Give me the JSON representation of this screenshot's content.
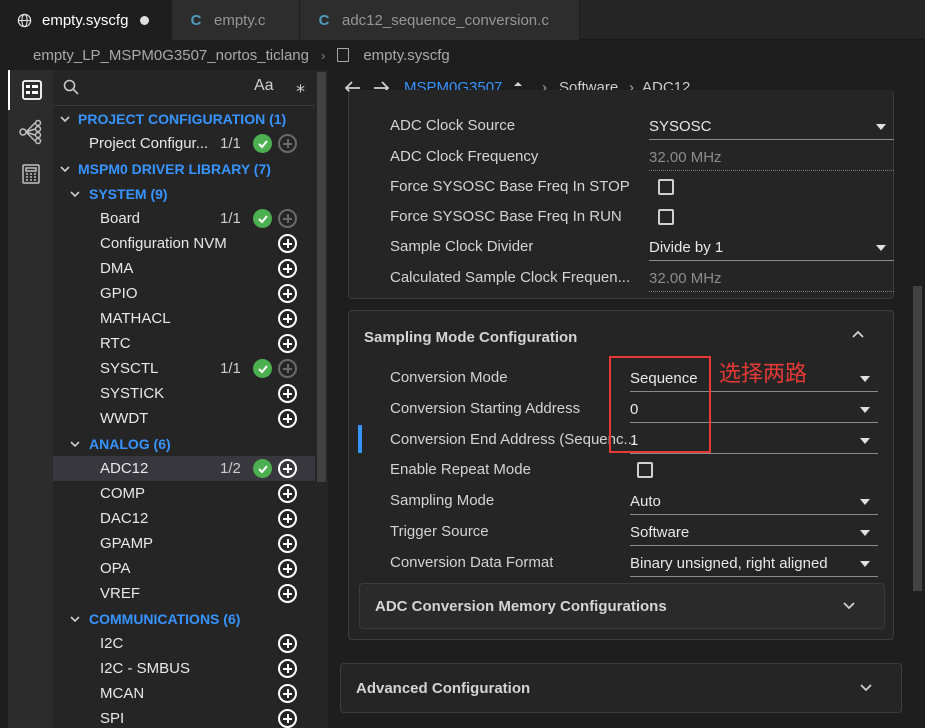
{
  "tabs": [
    {
      "label": "empty.syscfg",
      "icon": "globe-icon",
      "active": true,
      "modified": true
    },
    {
      "label": "empty.c",
      "icon": "c-file-icon",
      "active": false
    },
    {
      "label": "adc12_sequence_conversion.c",
      "icon": "c-file-icon",
      "active": false
    }
  ],
  "breadcrumb": {
    "project": "empty_LP_MSPM0G3507_nortos_ticlang",
    "file": "empty.syscfg"
  },
  "activity_bar": [
    "tree-view-icon",
    "hierarchy-icon",
    "calculator-icon"
  ],
  "tree": {
    "search_icon": "search-icon",
    "case_toggle": "Aa",
    "filter_icon": "asterisk-icon",
    "project_config": {
      "label": "PROJECT CONFIGURATION (1)",
      "items": [
        {
          "label": "Project Configur...",
          "count": "1/1",
          "ok": true
        }
      ]
    },
    "driver_library": {
      "label": "MSPM0 DRIVER LIBRARY (7)"
    },
    "system": {
      "label": "SYSTEM (9)",
      "items": [
        {
          "label": "Board",
          "count": "1/1"
        },
        {
          "label": "Configuration NVM"
        },
        {
          "label": "DMA"
        },
        {
          "label": "GPIO"
        },
        {
          "label": "MATHACL"
        },
        {
          "label": "RTC"
        },
        {
          "label": "SYSCTL",
          "count": "1/1"
        },
        {
          "label": "SYSTICK"
        },
        {
          "label": "WWDT"
        }
      ]
    },
    "analog": {
      "label": "ANALOG (6)",
      "items": [
        {
          "label": "ADC12",
          "count": "1/2"
        },
        {
          "label": "COMP"
        },
        {
          "label": "DAC12"
        },
        {
          "label": "GPAMP"
        },
        {
          "label": "OPA"
        },
        {
          "label": "VREF"
        }
      ]
    },
    "communications": {
      "label": "COMMUNICATIONS (6)",
      "items": [
        {
          "label": "I2C"
        },
        {
          "label": "I2C - SMBUS"
        },
        {
          "label": "MCAN"
        },
        {
          "label": "SPI"
        }
      ]
    }
  },
  "nav": {
    "back_icon": "arrow-left-icon",
    "forward_icon": "arrow-right-icon",
    "device": "MSPM0G3507",
    "path": [
      "Software",
      "ADC12"
    ]
  },
  "clock_props": [
    {
      "label": "ADC Clock Source",
      "value": "SYSOSC",
      "kind": "select"
    },
    {
      "label": "ADC Clock Frequency",
      "value": "32.00 MHz",
      "kind": "readonly"
    },
    {
      "label": "Force SYSOSC Base Freq In STOP ...",
      "kind": "checkbox",
      "checked": false
    },
    {
      "label": "Force SYSOSC Base Freq In RUN",
      "kind": "checkbox",
      "checked": false
    },
    {
      "label": "Sample Clock Divider",
      "value": "Divide by 1",
      "kind": "select"
    },
    {
      "label": "Calculated Sample Clock Frequen...",
      "value": "32.00 MHz",
      "kind": "readonly"
    }
  ],
  "sampling": {
    "title": "Sampling Mode Configuration",
    "props": [
      {
        "label": "Conversion Mode",
        "value": "Sequence",
        "kind": "select"
      },
      {
        "label": "Conversion Starting Address",
        "value": "0",
        "kind": "select"
      },
      {
        "label": "Conversion End Address (Sequenc...",
        "value": "1",
        "kind": "select"
      },
      {
        "label": "Enable Repeat Mode",
        "kind": "checkbox",
        "checked": false
      },
      {
        "label": "Sampling Mode",
        "value": "Auto",
        "kind": "select"
      },
      {
        "label": "Trigger Source",
        "value": "Software",
        "kind": "select"
      },
      {
        "label": "Conversion Data Format",
        "value": "Binary unsigned, right aligned",
        "kind": "select"
      }
    ],
    "memory_section": "ADC Conversion Memory Configurations"
  },
  "advanced_section": "Advanced Configuration",
  "annotation": "选择两路",
  "colors": {
    "link": "#3794ff",
    "ok": "#4caf50",
    "annotation": "#e53935"
  }
}
